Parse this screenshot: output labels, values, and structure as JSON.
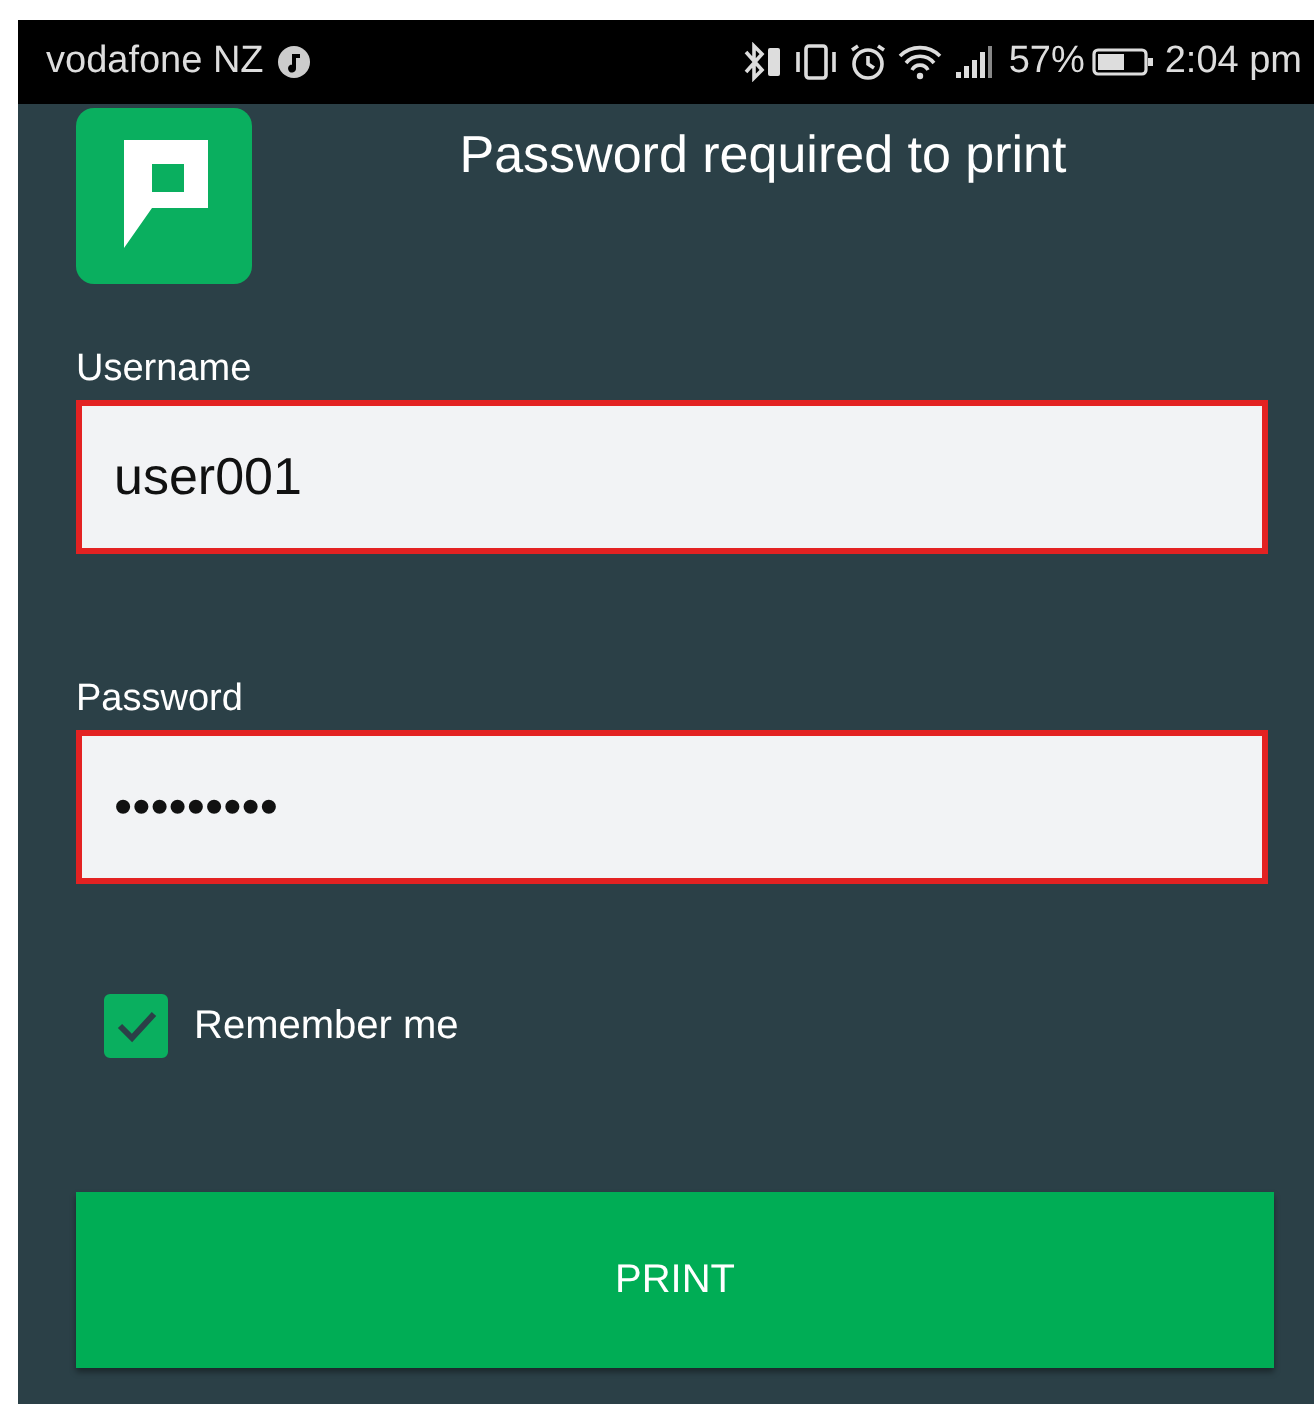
{
  "status_bar": {
    "carrier": "vodafone NZ",
    "battery": "57%",
    "time": "2:04 pm"
  },
  "dialog": {
    "title": "Password required to print"
  },
  "fields": [
    {
      "label": "Username",
      "value": "user001",
      "invalid": true
    },
    {
      "label": "Password",
      "value": "•••••••••",
      "invalid": true
    }
  ],
  "remember": {
    "label": "Remember me",
    "checked": true
  },
  "buttons": [
    {
      "label": "PRINT"
    }
  ]
}
